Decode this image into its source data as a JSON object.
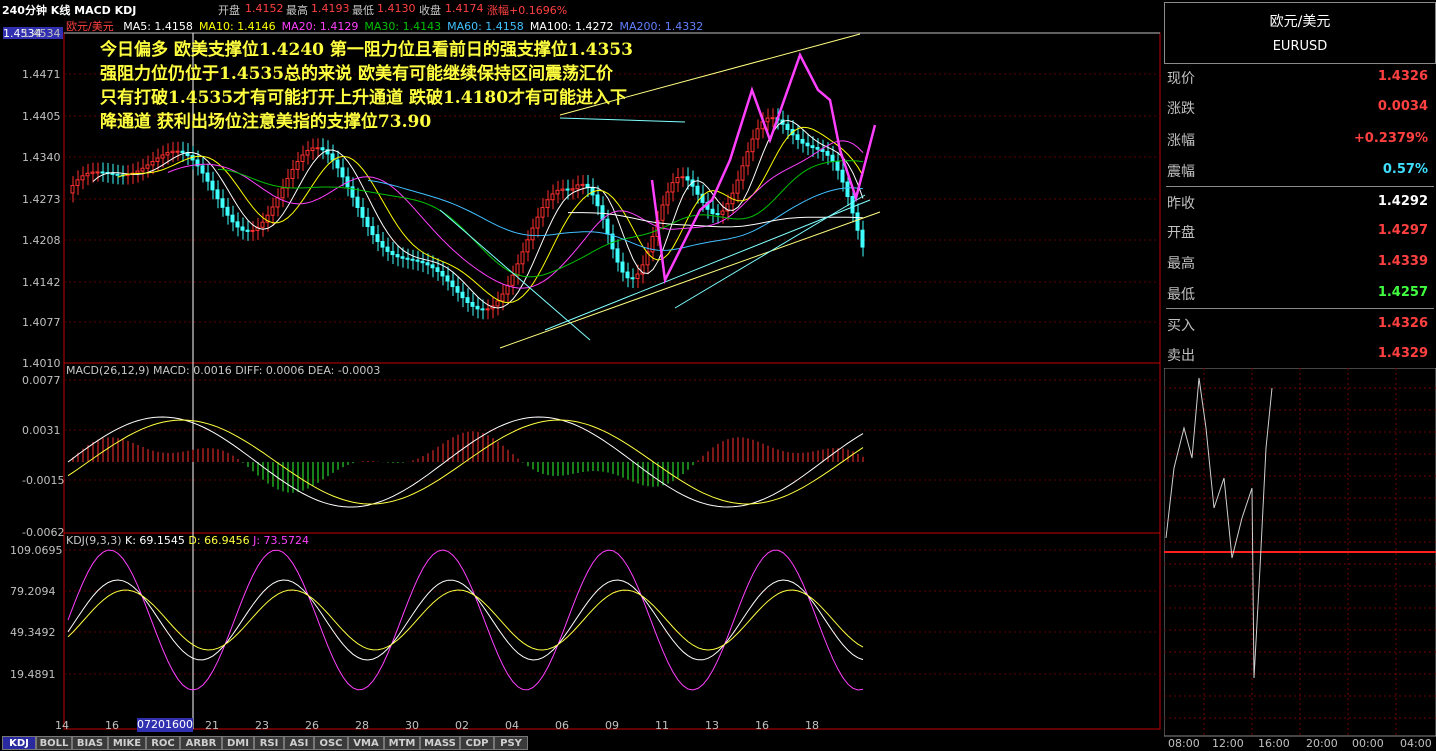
{
  "header": {
    "period_label": "240分钟 K线 MACD KDJ",
    "open_label": "开盘",
    "open": "1.4152",
    "high_label": "最高",
    "high": "1.4193",
    "low_label": "最低",
    "low": "1.4130",
    "close_label": "收盘",
    "close": "1.4174",
    "change_label": "涨幅",
    "change": "+0.1696%"
  },
  "price_panel": {
    "symbol": "欧元/美元",
    "ma_labels": [
      "MA5: 1.4158",
      "MA10: 1.4146",
      "MA20: 1.4129",
      "MA30: 1.4143",
      "MA60: 1.4158",
      "MA100: 1.4272",
      "MA200: 1.4332"
    ],
    "ma_colors": [
      "#ffffff",
      "#ffff00",
      "#ff40ff",
      "#00c000",
      "#40c0ff",
      "#ffffff",
      "#6080ff"
    ],
    "yaxis_labels": [
      "1.4534",
      "1.4471",
      "1.4405",
      "1.4340",
      "1.4273",
      "1.4208",
      "1.4142",
      "1.4077",
      "1.4010"
    ],
    "cursor_price": "1.4534",
    "annotation": [
      "今日偏多 欧美支撑位1.4240 第一阻力位且看前日的强支撑位1.4353",
      "强阻力位仍位于1.4535总的来说 欧美有可能继续保持区间震荡汇价",
      "只有打破1.4535才有可能打开上升通道 跌破1.4180才有可能进入下",
      "降通道 获利出场位注意美指的支撑位73.90"
    ]
  },
  "macd_panel": {
    "label": "MACD(26,12,9) MACD: 0.0016 DIFF: 0.0006 DEA: -0.0003",
    "yaxis_labels": [
      "0.0077",
      "0.0031",
      "-0.0015",
      "-0.0062"
    ]
  },
  "kdj_panel": {
    "label_prefix": "KDJ(9,3,3) ",
    "k": "K: 69.1545",
    "d": "D: 66.9456",
    "j": "J: 73.5724",
    "yaxis_labels": [
      "109.0695",
      "79.2094",
      "49.3492",
      "19.4891"
    ]
  },
  "xaxis": {
    "labels": [
      "14",
      "16",
      "21",
      "23",
      "26",
      "28",
      "30",
      "02",
      "04",
      "06",
      "09",
      "11",
      "13",
      "16",
      "18"
    ],
    "cursor_label": "07201600"
  },
  "quote": {
    "name": "欧元/美元",
    "code": "EURUSD",
    "rows": [
      {
        "label": "现价",
        "value": "1.4326",
        "color": "#ff4040"
      },
      {
        "label": "涨跌",
        "value": "0.0034",
        "color": "#ff4040"
      },
      {
        "label": "涨幅",
        "value": "+0.2379%",
        "color": "#ff4040"
      },
      {
        "label": "震幅",
        "value": "0.57%",
        "color": "#40e0ff"
      },
      {
        "label": "昨收",
        "value": "1.4292",
        "color": "#ffffff"
      },
      {
        "label": "开盘",
        "value": "1.4297",
        "color": "#ff4040"
      },
      {
        "label": "最高",
        "value": "1.4339",
        "color": "#ff4040"
      },
      {
        "label": "最低",
        "value": "1.4257",
        "color": "#40ff40"
      },
      {
        "label": "买入",
        "value": "1.4326",
        "color": "#ff4040"
      },
      {
        "label": "卖出",
        "value": "1.4329",
        "color": "#ff4040"
      }
    ]
  },
  "mini_chart": {
    "time_labels": [
      "08:00",
      "12:00",
      "16:00",
      "20:00",
      "00:00",
      "04:00"
    ]
  },
  "tabs": [
    "KDJ",
    "BOLL",
    "BIAS",
    "MIKE",
    "ROC",
    "ARBR",
    "DMI",
    "RSI",
    "ASI",
    "OSC",
    "VMA",
    "MTM",
    "MASS",
    "CDP",
    "PSY"
  ],
  "colors": {
    "up": "#ff3030",
    "down": "#40ffff",
    "grid": "#800000",
    "axis": "#c00000"
  }
}
